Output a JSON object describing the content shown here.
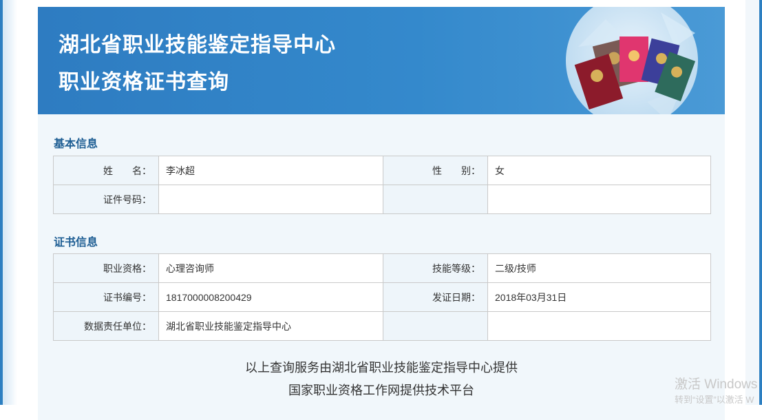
{
  "header": {
    "title_line1": "湖北省职业技能鉴定指导中心",
    "title_line2": "职业资格证书查询"
  },
  "basic_info": {
    "section_title": "基本信息",
    "name_label": "姓　　名：",
    "name_value": "李冰超",
    "gender_label": "性　　别：",
    "gender_value": "女",
    "id_label": "证件号码：",
    "id_value": ""
  },
  "cert_info": {
    "section_title": "证书信息",
    "qualification_label": "职业资格：",
    "qualification_value": "心理咨询师",
    "skill_level_label": "技能等级：",
    "skill_level_value": "二级/技师",
    "cert_no_label": "证书编号：",
    "cert_no_value": "1817000008200429",
    "issue_date_label": "发证日期：",
    "issue_date_value": "2018年03月31日",
    "unit_label": "数据责任单位：",
    "unit_value": "湖北省职业技能鉴定指导中心"
  },
  "footer": {
    "line1": "以上查询服务由湖北省职业技能鉴定指导中心提供",
    "line2": "国家职业资格工作网提供技术平台"
  },
  "watermark": {
    "line1": "激活 Windows",
    "line2": "转到“设置”以激活 W"
  },
  "colors": {
    "banner": "#2e7cc1",
    "section_title": "#1d5d93",
    "label_bg": "#eef5fa",
    "card_bg": "#f1f7fb"
  }
}
